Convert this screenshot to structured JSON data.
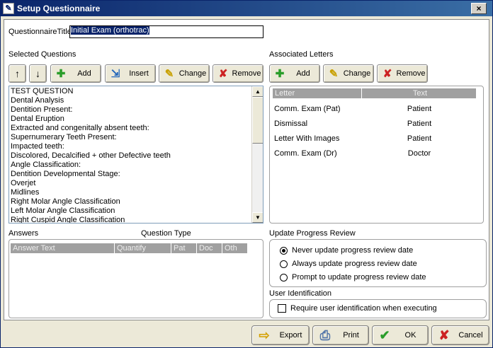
{
  "window": {
    "title": "Setup Questionnaire",
    "close_label": "×"
  },
  "form": {
    "title_label": "QuestionnaireTitle",
    "title_value": "Initial Exam (orthotrac)"
  },
  "selected_questions": {
    "label": "Selected Questions",
    "buttons": {
      "up": "↑",
      "down": "↓",
      "add": "Add",
      "insert": "Insert",
      "change": "Change",
      "remove": "Remove"
    },
    "items": [
      "TEST QUESTION",
      "Dental Analysis",
      "Dentition Present:",
      "Dental Eruption",
      "Extracted and congenitally absent teeth:",
      "Supernumerary Teeth Present:",
      "Impacted teeth:",
      "Discolored, Decalcified + other Defective teeth",
      "Angle Classification:",
      "Dentition Developmental Stage:",
      "Overjet",
      "Midlines",
      "Right Molar Angle Classification",
      "Left Molar Angle Classification",
      "Right Cuspid Angle Classification"
    ]
  },
  "associated_letters": {
    "label": "Associated Letters",
    "buttons": {
      "add": "Add",
      "change": "Change",
      "remove": "Remove"
    },
    "columns": [
      "Letter",
      "Text"
    ],
    "rows": [
      {
        "letter": "Comm. Exam (Pat)",
        "text": "Patient"
      },
      {
        "letter": "Dismissal",
        "text": "Patient"
      },
      {
        "letter": "Letter With Images",
        "text": "Patient"
      },
      {
        "letter": "Comm. Exam (Dr)",
        "text": "Doctor"
      }
    ]
  },
  "answers": {
    "label": "Answers",
    "question_type_label": "Question Type",
    "columns": [
      "Answer Text",
      "Quantify",
      "Pat",
      "Doc",
      "Oth"
    ]
  },
  "update_progress": {
    "label": "Update Progress Review",
    "options": [
      "Never update progress review date",
      "Always update progress review date",
      "Prompt to update progress review date"
    ],
    "selected_index": 0
  },
  "user_identification": {
    "label": "User Identification",
    "checkbox_label": "Require user identification when executing",
    "checked": false
  },
  "footer": {
    "export": "Export",
    "print": "Print",
    "ok": "OK",
    "cancel": "Cancel"
  },
  "colors": {
    "title_bar": "#0a246a",
    "window_bg": "#ece9d8",
    "grid_header": "#a0a0a0",
    "ok_green": "#2a9d2a",
    "cancel_red": "#cc2222"
  }
}
